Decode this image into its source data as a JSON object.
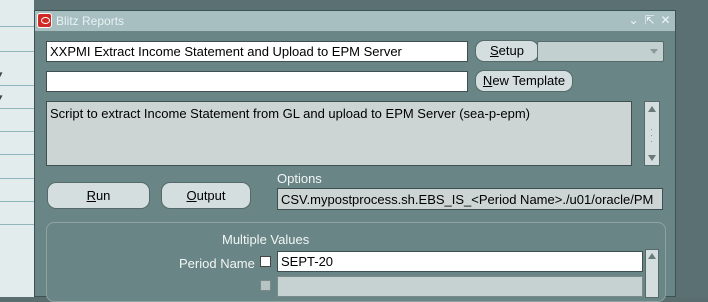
{
  "window": {
    "title": "Blitz Reports"
  },
  "title_controls": {
    "minimize": "⌄",
    "restore": "⇱",
    "close": "✕"
  },
  "report": {
    "name_value": "XXPMI Extract Income Statement and Upload to EPM Server",
    "template_value": "",
    "description": "Script to extract Income Statement from GL and upload to EPM Server (sea-p-epm)",
    "type_select_value": ""
  },
  "buttons": {
    "setup": {
      "accel": "S",
      "rest": "etup"
    },
    "new_template": {
      "accel": "N",
      "rest": "ew Template"
    },
    "run": {
      "accel": "R",
      "rest": "un"
    },
    "output": {
      "accel": "O",
      "rest": "utput"
    }
  },
  "options": {
    "label": "Options",
    "value": "CSV.mypostprocess.sh.EBS_IS_<Period Name>./u01/oracle/PM"
  },
  "parameters": {
    "multiple_values_label": "Multiple Values",
    "rows": [
      {
        "label": "Period Name",
        "checked": false,
        "value": "SEPT-20"
      },
      {
        "label": "",
        "checked": false,
        "value": ""
      }
    ]
  },
  "icons": {
    "app": "oracle-app-icon",
    "dropdown": "chevron-down-icon",
    "scroll_up": "arrow-up-icon",
    "scroll_down": "arrow-down-icon"
  }
}
